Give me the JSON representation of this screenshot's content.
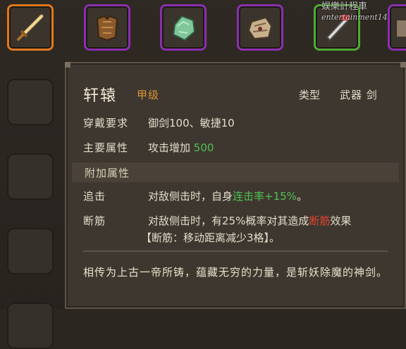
{
  "inventory": {
    "slots": [
      {
        "icon": "sword-icon",
        "rarity_color": "#e0781c"
      },
      {
        "icon": "leather-armor-icon",
        "rarity_color": "#8b2fb0"
      },
      {
        "icon": "jade-stone-icon",
        "rarity_color": "#8b2fb0"
      },
      {
        "icon": "pouch-icon",
        "rarity_color": "#8b2fb0"
      },
      {
        "icon": "blade-icon",
        "rarity_color": "#52a935"
      },
      {
        "icon": "partial-item-icon",
        "rarity_color": "#8b2fb0"
      }
    ]
  },
  "tooltip": {
    "name": "轩辕",
    "grade": "甲级",
    "type_label": "类型",
    "type_value": "武器 剑",
    "requirement_label": "穿戴要求",
    "requirement_value": "御剑100、敏捷10",
    "main_attr_label": "主要属性",
    "main_attr_text": "攻击增加",
    "main_attr_value": "500",
    "extra_section": "附加属性",
    "extras": [
      {
        "label": "追击",
        "text_pre": "对敌侧击时，自身",
        "highlight": "连击率+15%",
        "text_post": "。"
      },
      {
        "label": "断筋",
        "text_pre": "对敌侧击时，有25%概率对其造成",
        "highlight": "断筋",
        "text_post": "效果",
        "line2": "【断筋：移动距离减少3格】。"
      }
    ],
    "description": "相传为上古一帝所铸，蕴藏无穷的力量，是斩妖除魔的神剑。"
  },
  "watermark": {
    "line1": "娱樂計程車",
    "line2": "entertainment14"
  },
  "colors": {
    "highlight_green": "#4fc24f",
    "highlight_red": "#e0442f",
    "grade_orange": "#d9943a"
  }
}
